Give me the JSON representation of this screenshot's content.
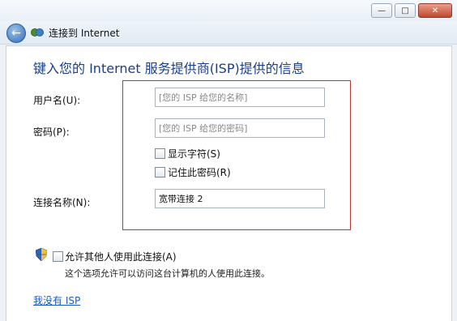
{
  "window": {
    "controls": {
      "minimize": "—",
      "maximize": "□",
      "close": "✕"
    },
    "nav_title": "连接到 Internet"
  },
  "main": {
    "heading": "键入您的 Internet 服务提供商(ISP)提供的信息",
    "fields": {
      "username": {
        "label": "用户名(U):",
        "placeholder": "[您的 ISP 给您的名称]"
      },
      "password": {
        "label": "密码(P):",
        "placeholder": "[您的 ISP 给您的密码]"
      },
      "show_chars": {
        "label": "显示字符(S)",
        "checked": false
      },
      "remember": {
        "label": "记住此密码(R)",
        "checked": false
      },
      "connection_name": {
        "label": "连接名称(N):",
        "value": "宽带连接 2"
      }
    },
    "allow_others": {
      "label": "允许其他人使用此连接(A)",
      "checked": false,
      "note": "这个选项允许可以访问这台计算机的人使用此连接。"
    },
    "no_isp_link": "我没有 ISP"
  },
  "colors": {
    "heading": "#1a3e8c",
    "highlight_box": "#b8382f",
    "link": "#1a5bbf"
  },
  "icons": {
    "back": "back-arrow-icon",
    "network": "network-icon",
    "shield": "uac-shield-icon"
  }
}
